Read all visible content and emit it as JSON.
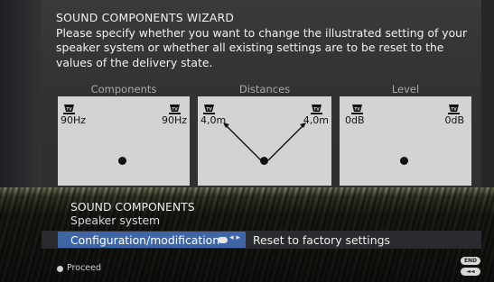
{
  "wizard": {
    "title": "SOUND COMPONENTS WIZARD",
    "description": "Please specify whether you want to change the illustrated setting of your speaker system or whether all existing settings are to be reset to the values of the delivery state."
  },
  "panels": {
    "components": {
      "label": "Components",
      "left_value": "90Hz",
      "right_value": "90Hz"
    },
    "distances": {
      "label": "Distances",
      "left_value": "4,0m",
      "right_value": "4,0m"
    },
    "level": {
      "label": "Level",
      "left_value": "0dB",
      "right_value": "0dB"
    }
  },
  "menu": {
    "title": "SOUND COMPONENTS",
    "subtitle": "Speaker system",
    "selected_option": "Configuration/modification",
    "ok_icon": "ok-button",
    "other_option": "Reset to factory settings"
  },
  "footer": {
    "proceed_label": "Proceed",
    "end_label": "END",
    "back_label": "◄◄"
  },
  "colors": {
    "selection_blue": "#3e66a6",
    "panel_gray": "#d3d3d3"
  }
}
